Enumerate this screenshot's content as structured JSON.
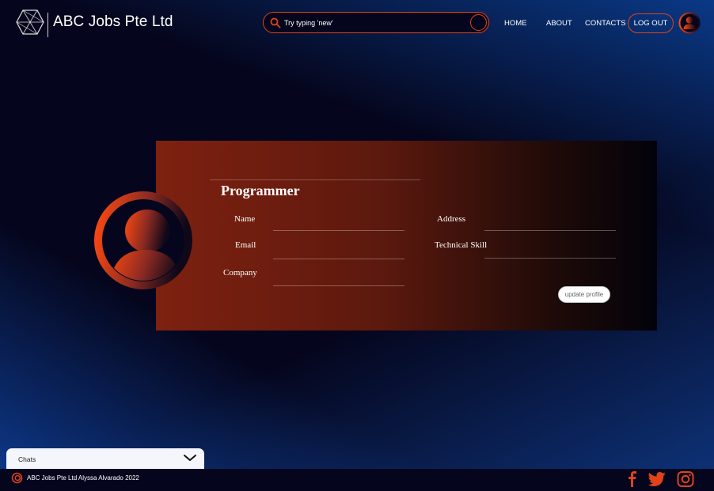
{
  "header": {
    "brand": "ABC Jobs Pte Ltd",
    "search_placeholder": "Try typing 'new'",
    "nav": {
      "home": "HOME",
      "about": "ABOUT",
      "contacts": "CONTACTS"
    },
    "logout_label": "LOG OUT"
  },
  "profile": {
    "role": "Programmer",
    "labels": {
      "name": "Name",
      "email": "Email",
      "company": "Company",
      "address": "Address",
      "technical_skill": "Technical Skill"
    },
    "update_label": "update profile"
  },
  "chat": {
    "label": "Chats"
  },
  "footer": {
    "text": "ABC Jobs Pte Ltd Alyssa Alvarado 2022"
  },
  "colors": {
    "accent": "#e0421a",
    "background": "#05061d",
    "card_start": "#7e2110",
    "card_end": "#02020a"
  },
  "icons": [
    "logo-icon",
    "search-icon",
    "avatar-icon",
    "chevron-down-icon",
    "facebook-icon",
    "twitter-icon",
    "instagram-icon"
  ]
}
